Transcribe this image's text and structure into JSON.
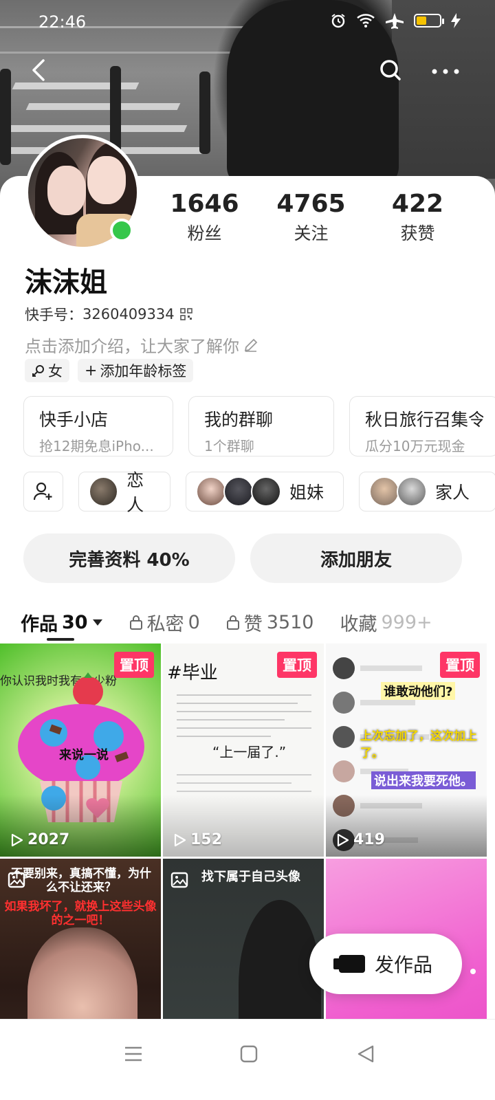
{
  "status_bar": {
    "time": "22:46"
  },
  "profile": {
    "name": "沫沫姐",
    "user_id_label": "快手号：",
    "user_id": "3260409334",
    "intro_placeholder": "点击添加介绍，让大家了解你",
    "online": true
  },
  "stats": [
    {
      "value": "1646",
      "label": "粉丝"
    },
    {
      "value": "4765",
      "label": "关注"
    },
    {
      "value": "422",
      "label": "获赞"
    }
  ],
  "tags": {
    "gender": "女",
    "add_age": "添加年龄标签"
  },
  "shortcuts": [
    {
      "title": "快手小店",
      "subtitle": "抢12期免息iPho..."
    },
    {
      "title": "我的群聊",
      "subtitle": "1个群聊"
    },
    {
      "title": "秋日旅行召集令",
      "subtitle": "瓜分10万元现金"
    }
  ],
  "relations": [
    {
      "label": "恋人"
    },
    {
      "label": "姐妹"
    },
    {
      "label": "家人"
    }
  ],
  "actions": {
    "complete_profile": "完善资料 40%",
    "add_friend": "添加朋友"
  },
  "tabs": [
    {
      "label": "作品",
      "count": "30"
    },
    {
      "label": "私密",
      "count": "0"
    },
    {
      "label": "赞",
      "count": "3510"
    },
    {
      "label": "收藏",
      "count": "999+"
    }
  ],
  "grid": [
    {
      "pinned": true,
      "pin_label": "置顶",
      "plays": "2027",
      "caption": "你认识我时我有多少粉",
      "caption2": "来说一说"
    },
    {
      "pinned": true,
      "pin_label": "置顶",
      "plays": "152",
      "caption": "#毕业",
      "caption2": "“上一届了.”"
    },
    {
      "pinned": true,
      "pin_label": "置顶",
      "plays": "419",
      "caption": "谁敢动他们?",
      "caption2": "上次忘加了，这次加上了。",
      "caption3": "说出来我要死他。"
    },
    {
      "pinned": false,
      "caption": "不要别来，真搞不懂，为什么不让还来？",
      "caption2": "如果我坏了，就换上这些头像的之一吧！"
    },
    {
      "pinned": false,
      "caption": "找下属于自己头像"
    },
    {
      "pinned": false
    }
  ],
  "publish": {
    "label": "发作品"
  },
  "colors": {
    "accent_pin": "#fe3666",
    "online": "#35c74a",
    "battery": "#f5c200"
  }
}
